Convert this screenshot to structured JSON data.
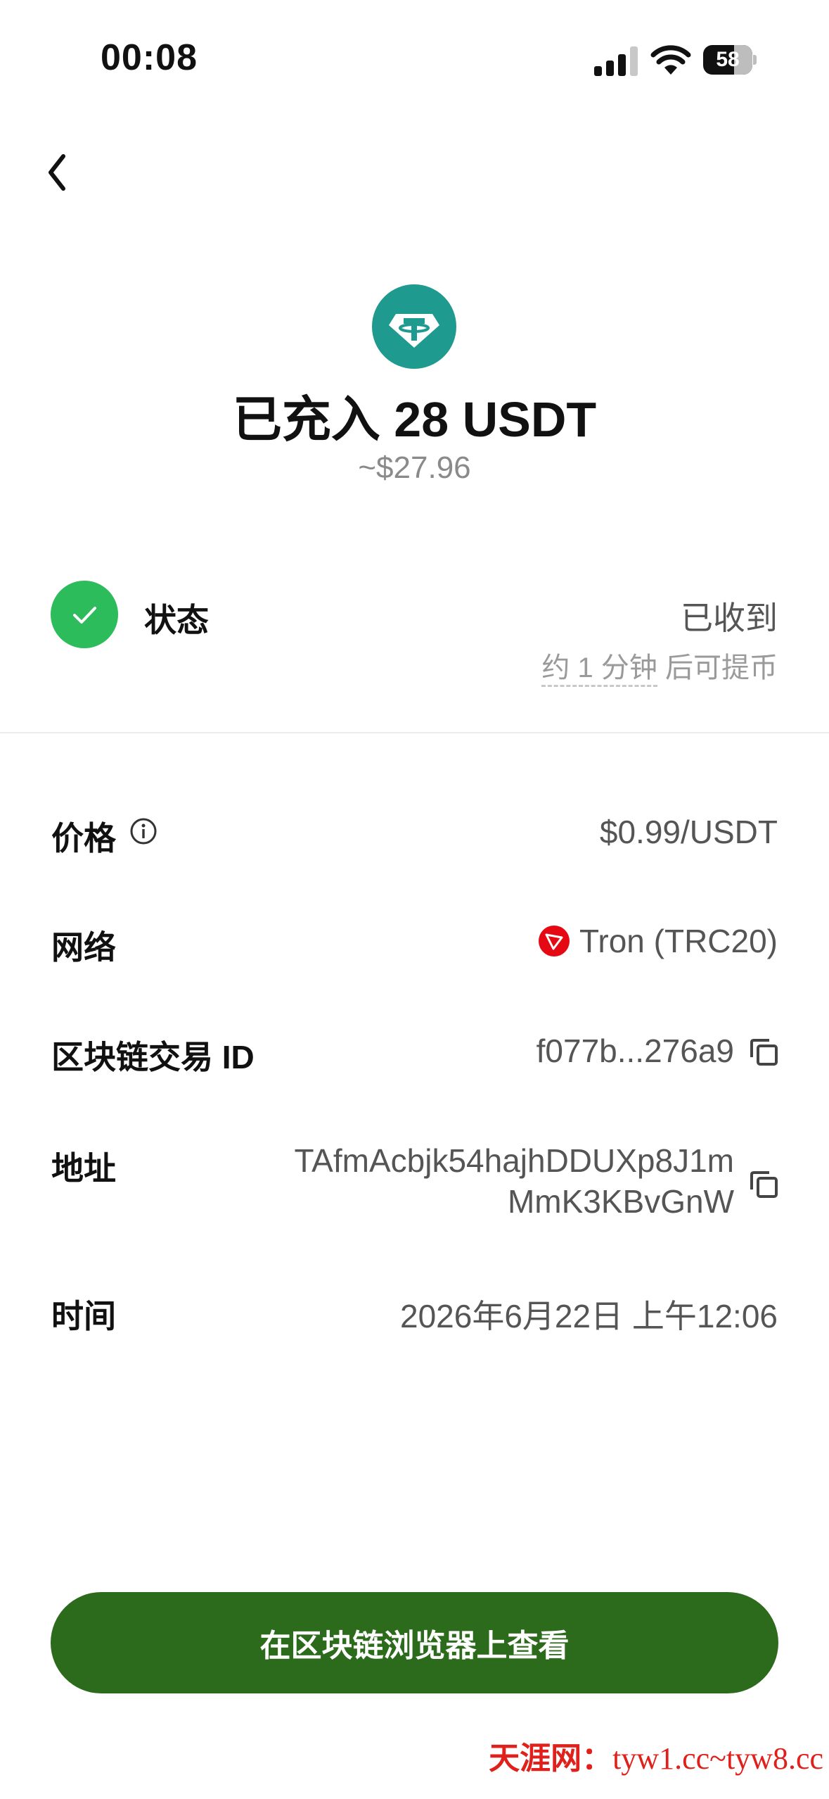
{
  "status_bar": {
    "time": "00:08",
    "battery": "58",
    "icons": [
      "signal-icon",
      "wifi-icon",
      "battery-icon"
    ]
  },
  "nav": {
    "back_icon": "chevron-left-icon"
  },
  "hero": {
    "token_icon": "tether-usdt-icon",
    "token_color": "#1f9a8f",
    "title": "已充入 28 USDT",
    "subtitle": "~$27.96"
  },
  "status": {
    "icon": "check-circle-icon",
    "icon_color": "#2dbc5c",
    "label": "状态",
    "value": "已收到",
    "note_prefix": "约 1 分钟",
    "note_suffix": " 后可提币"
  },
  "details": {
    "price": {
      "label": "价格",
      "icon": "info-icon",
      "value": "$0.99/USDT"
    },
    "network": {
      "label": "网络",
      "icon": "tron-icon",
      "value": "Tron (TRC20)"
    },
    "txid": {
      "label": "区块链交易 ID",
      "value": "f077b...276a9",
      "icon": "copy-icon"
    },
    "address": {
      "label": "地址",
      "line1": "TAfmAcbjk54hajhDDUXp8J1m",
      "line2": "MmK3KBvGnW",
      "icon": "copy-icon"
    },
    "time": {
      "label": "时间",
      "value": "2026年6月22日 上午12:06"
    }
  },
  "action": {
    "label": "在区块链浏览器上查看",
    "color": "#2c6b1b"
  },
  "watermark": {
    "brand": "天涯网：",
    "domain": "tyw1.cc~tyw8.cc"
  }
}
